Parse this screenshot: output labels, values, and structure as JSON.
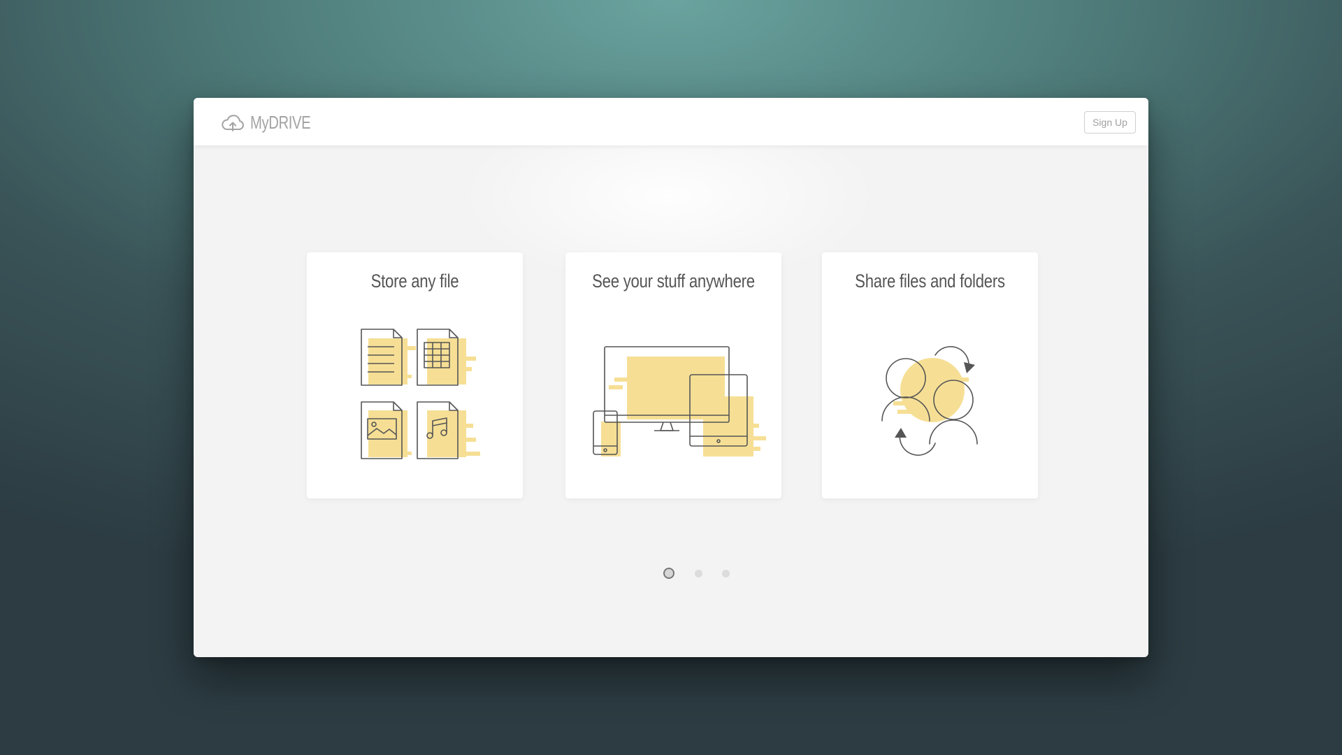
{
  "app": {
    "name": "MyDRIVE",
    "logo_icon": "cloud-upload-icon",
    "signup_label": "Sign Up"
  },
  "cards": [
    {
      "title": "Store any file",
      "icon": "file-types-illustration"
    },
    {
      "title": "See your stuff anywhere",
      "icon": "devices-illustration"
    },
    {
      "title": "Share files and folders",
      "icon": "share-people-illustration"
    }
  ],
  "pagination": {
    "total": 3,
    "active": 1
  },
  "colors": {
    "accent": "#f6df95",
    "stroke": "#555555",
    "window_bg": "#f3f3f3",
    "card_bg": "#ffffff"
  }
}
